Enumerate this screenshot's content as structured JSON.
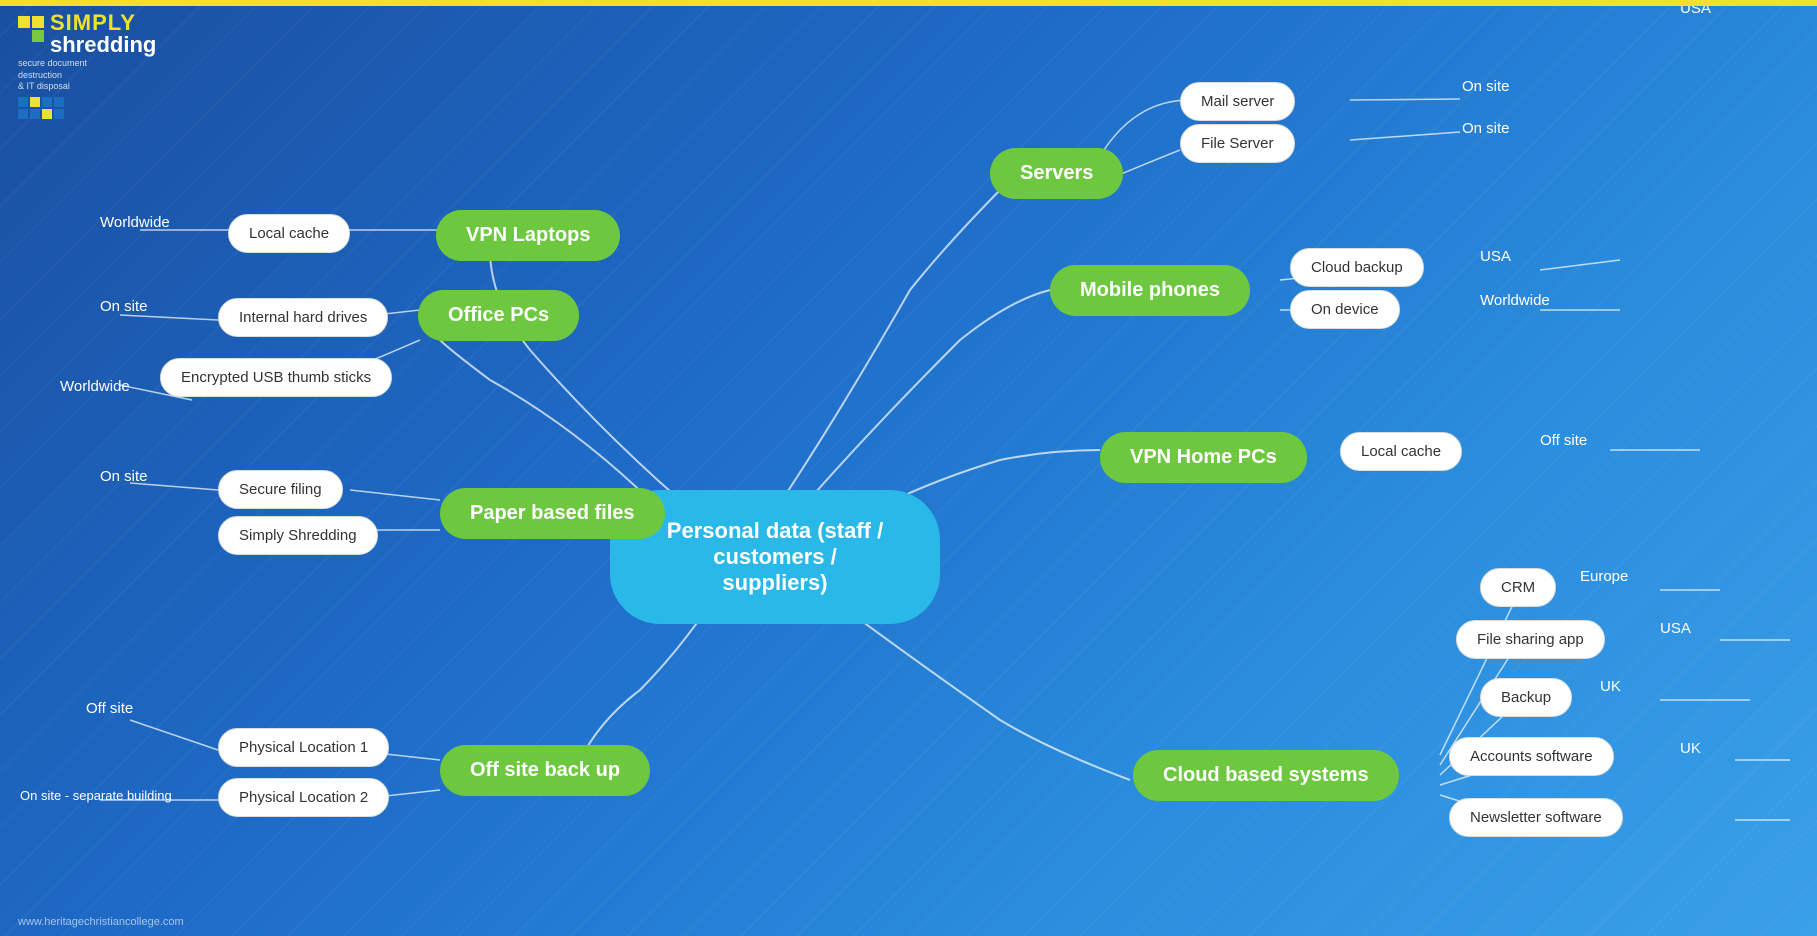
{
  "logo": {
    "simply": "SIMPLY",
    "shredding": "shredding",
    "sub1": "secure document",
    "sub2": "destruction",
    "sub3": "& IT disposal"
  },
  "footer": {
    "url": "www.heritagechristiancollege.com"
  },
  "center": {
    "label": "Personal data (staff /\ncustomers / suppliers)"
  },
  "categories": {
    "servers": "Servers",
    "vpn_laptops": "VPN Laptops",
    "office_pcs": "Office PCs",
    "paper_files": "Paper based files",
    "offsite_backup": "Off site back up",
    "cloud_systems": "Cloud based systems",
    "vpn_home": "VPN Home PCs",
    "mobile_phones": "Mobile phones"
  },
  "nodes": {
    "mail_server": "Mail server",
    "file_server": "File Server",
    "on_site_1": "On site",
    "on_site_2": "On site",
    "local_cache_vpn": "Local cache",
    "worldwide_vpn": "Worldwide",
    "internal_hd": "Internal hard drives",
    "encrypted_usb": "Encrypted USB thumb sticks",
    "on_site_hd": "On site",
    "worldwide_usb": "Worldwide",
    "secure_filing": "Secure filing",
    "simply_shredding": "Simply Shredding",
    "on_site_filing": "On site",
    "phys_loc1": "Physical Location 1",
    "phys_loc2": "Physical Location 2",
    "offsite_phys": "Off site",
    "onsite_sep": "On site - separate building",
    "crm": "CRM",
    "file_sharing": "File sharing app",
    "backup": "Backup",
    "accounts": "Accounts software",
    "newsletter": "Newsletter software",
    "europe": "Europe",
    "usa_fs": "USA",
    "uk_backup": "UK",
    "uk_accounts": "UK",
    "usa_newsletter": "USA",
    "local_cache_home": "Local cache",
    "off_site_home": "Off site",
    "cloud_backup": "Cloud backup",
    "on_device": "On device",
    "usa_cloud": "USA",
    "worldwide_device": "Worldwide"
  }
}
